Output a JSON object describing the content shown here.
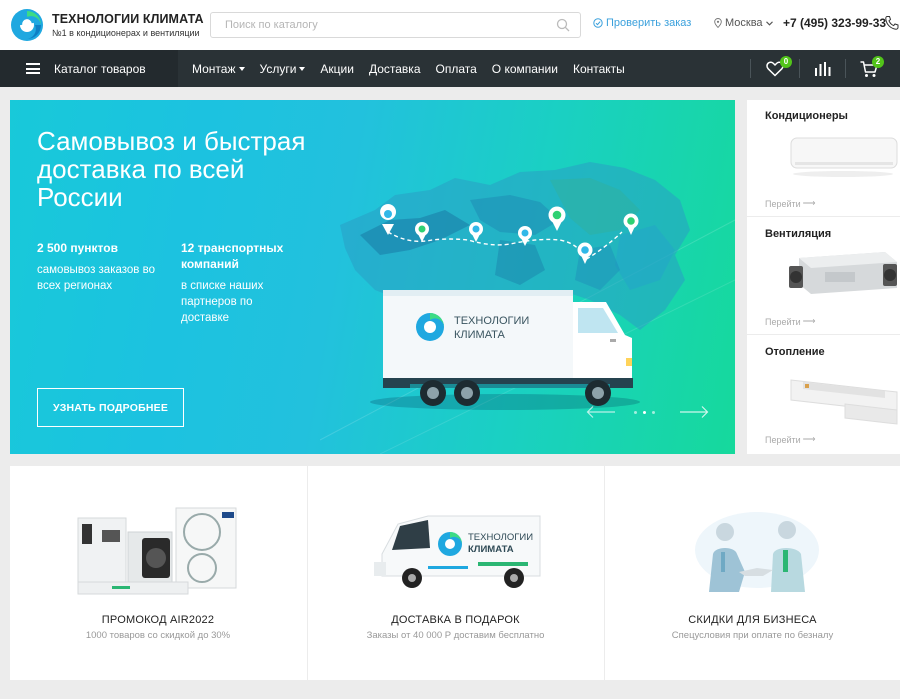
{
  "brand": {
    "title": "ТЕХНОЛОГИИ КЛИМАТА",
    "subtitle": "№1 в кондиционерах и вентиляции"
  },
  "header": {
    "search_placeholder": "Поиск по каталогу",
    "check_order": "Проверить заказ",
    "city": "Москва",
    "phone": "+7 (495) 323-99-33"
  },
  "nav": {
    "catalog": "Каталог товаров",
    "links": [
      "Монтаж",
      "Услуги",
      "Акции",
      "Доставка",
      "Оплата",
      "О компании",
      "Контакты"
    ],
    "favorites_count": "0",
    "cart_count": "2"
  },
  "banner": {
    "title": "Самовывоз и быстрая доставка по всей России",
    "stat1_head": "2 500 пунктов",
    "stat1_text": "самовывоз заказов во всех регионах",
    "stat2_head": "12 транспортных компаний",
    "stat2_text": "в списке наших партнеров по доставке",
    "button": "УЗНАТЬ ПОДРОБНЕЕ",
    "truck_brand_line1": "ТЕХНОЛОГИИ",
    "truck_brand_line2": "КЛИМАТА"
  },
  "categories": [
    {
      "title": "Кондиционеры",
      "link": "Перейти"
    },
    {
      "title": "Вентиляция",
      "link": "Перейти"
    },
    {
      "title": "Отопление",
      "link": "Перейти"
    }
  ],
  "promos": [
    {
      "title": "ПРОМОКОД AIR2022",
      "subtitle": "1000 товаров со скидкой до 30%"
    },
    {
      "title": "ДОСТАВКА В ПОДАРОК",
      "subtitle": "Заказы от 40 000 Р доставим бесплатно",
      "van_line1": "ТЕХНОЛОГИИ",
      "van_line2": "КЛИМАТА"
    },
    {
      "title": "СКИДКИ ДЛЯ БИЗНЕСА",
      "subtitle": "Спецусловия при оплате по безналу"
    }
  ],
  "colors": {
    "accent": "#3aa0dc",
    "nav_bg": "#2a3236",
    "badge": "#52c41a",
    "banner_start": "#18c9d9",
    "banner_end": "#16d99c"
  }
}
